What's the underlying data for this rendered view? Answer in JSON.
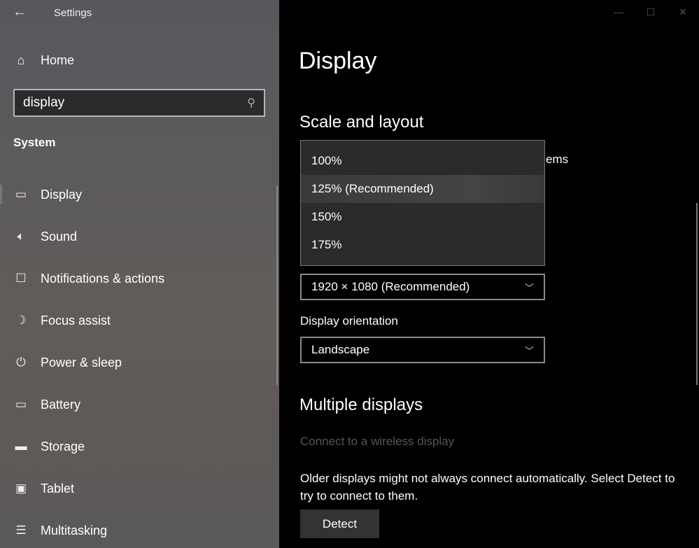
{
  "window": {
    "title": "Settings",
    "back_icon": "arrow-left-icon",
    "controls": [
      "minimize",
      "maximize",
      "close"
    ]
  },
  "sidebar": {
    "home": "Home",
    "search": {
      "value": "display",
      "icon": "search-icon"
    },
    "section": "System",
    "items": [
      {
        "label": "Display",
        "icon": "monitor-icon",
        "selected": true
      },
      {
        "label": "Sound",
        "icon": "speaker-icon"
      },
      {
        "label": "Notifications & actions",
        "icon": "message-icon"
      },
      {
        "label": "Focus assist",
        "icon": "moon-icon"
      },
      {
        "label": "Power & sleep",
        "icon": "power-icon"
      },
      {
        "label": "Battery",
        "icon": "battery-icon"
      },
      {
        "label": "Storage",
        "icon": "storage-icon"
      },
      {
        "label": "Tablet",
        "icon": "tablet-icon"
      },
      {
        "label": "Multitasking",
        "icon": "multitasking-icon"
      }
    ]
  },
  "main": {
    "title": "Display",
    "scale_section": "Scale and layout",
    "scale_dropdown": {
      "options": [
        "100%",
        "125% (Recommended)",
        "150%",
        "175%"
      ],
      "highlighted": "125% (Recommended)"
    },
    "partial_text": "ems",
    "resolution": "1920 × 1080 (Recommended)",
    "orientation_label": "Display orientation",
    "orientation": "Landscape",
    "multi_section": "Multiple displays",
    "wireless_link": "Connect to a wireless display",
    "older_text": "Older displays might not always connect automatically. Select Detect to try to connect to them.",
    "detect_button": "Detect"
  }
}
